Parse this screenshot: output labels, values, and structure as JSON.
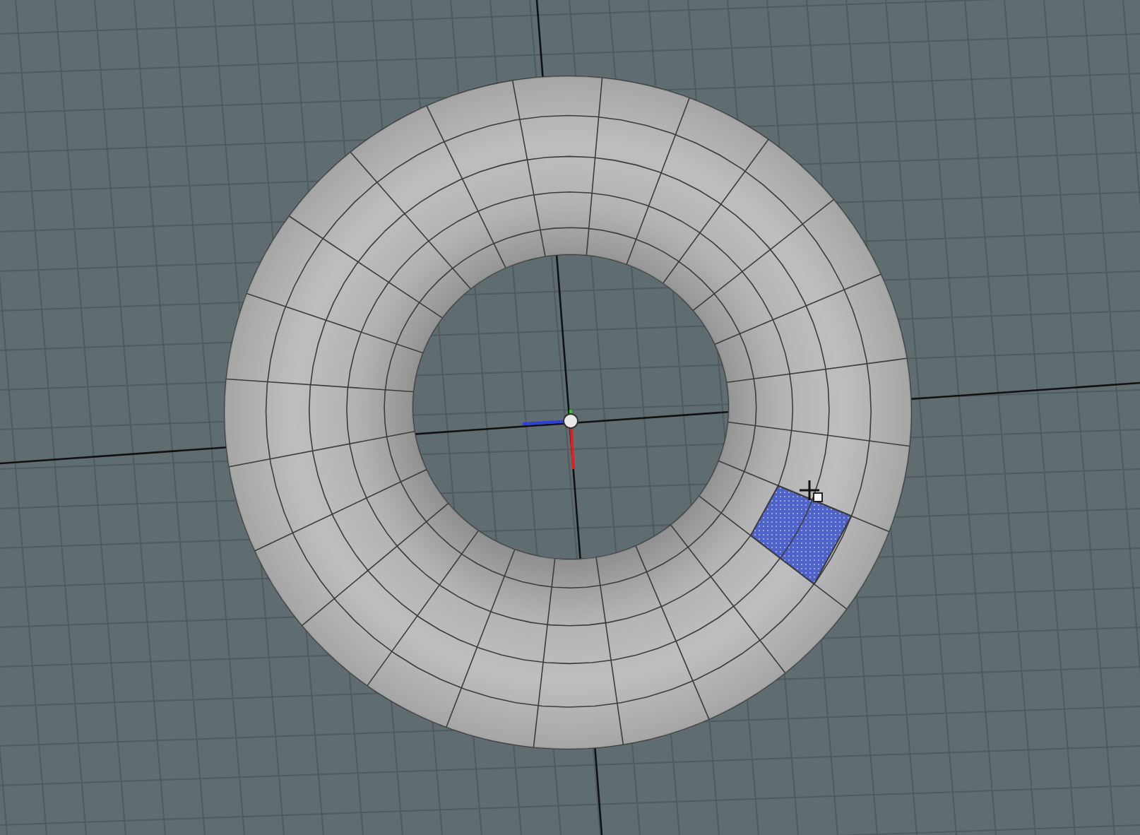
{
  "viewport": {
    "grid": true,
    "face_selected": true
  }
}
